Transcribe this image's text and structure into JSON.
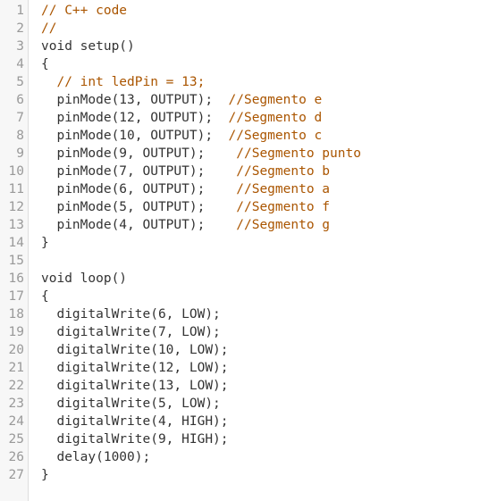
{
  "editor": {
    "lines": [
      {
        "n": "1",
        "code": "",
        "comment": "// C++ code"
      },
      {
        "n": "2",
        "code": "",
        "comment": "//"
      },
      {
        "n": "3",
        "code": "void setup()",
        "comment": ""
      },
      {
        "n": "4",
        "code": "{",
        "comment": ""
      },
      {
        "n": "5",
        "code": "  ",
        "comment": "// int ledPin = 13;"
      },
      {
        "n": "6",
        "code": "  pinMode(13, OUTPUT);  ",
        "comment": "//Segmento e"
      },
      {
        "n": "7",
        "code": "  pinMode(12, OUTPUT);  ",
        "comment": "//Segmento d"
      },
      {
        "n": "8",
        "code": "  pinMode(10, OUTPUT);  ",
        "comment": "//Segmento c"
      },
      {
        "n": "9",
        "code": "  pinMode(9, OUTPUT);    ",
        "comment": "//Segmento punto"
      },
      {
        "n": "10",
        "code": "  pinMode(7, OUTPUT);    ",
        "comment": "//Segmento b"
      },
      {
        "n": "11",
        "code": "  pinMode(6, OUTPUT);    ",
        "comment": "//Segmento a"
      },
      {
        "n": "12",
        "code": "  pinMode(5, OUTPUT);    ",
        "comment": "//Segmento f"
      },
      {
        "n": "13",
        "code": "  pinMode(4, OUTPUT);    ",
        "comment": "//Segmento g"
      },
      {
        "n": "14",
        "code": "}",
        "comment": ""
      },
      {
        "n": "15",
        "code": "",
        "comment": ""
      },
      {
        "n": "16",
        "code": "void loop()",
        "comment": ""
      },
      {
        "n": "17",
        "code": "{",
        "comment": ""
      },
      {
        "n": "18",
        "code": "  digitalWrite(6, LOW);",
        "comment": ""
      },
      {
        "n": "19",
        "code": "  digitalWrite(7, LOW);",
        "comment": ""
      },
      {
        "n": "20",
        "code": "  digitalWrite(10, LOW);",
        "comment": ""
      },
      {
        "n": "21",
        "code": "  digitalWrite(12, LOW);",
        "comment": ""
      },
      {
        "n": "22",
        "code": "  digitalWrite(13, LOW);",
        "comment": ""
      },
      {
        "n": "23",
        "code": "  digitalWrite(5, LOW);",
        "comment": ""
      },
      {
        "n": "24",
        "code": "  digitalWrite(4, HIGH);",
        "comment": ""
      },
      {
        "n": "25",
        "code": "  digitalWrite(9, HIGH);",
        "comment": ""
      },
      {
        "n": "26",
        "code": "  delay(1000);",
        "comment": ""
      },
      {
        "n": "27",
        "code": "}",
        "comment": ""
      }
    ],
    "colors": {
      "code": "#333333",
      "comment": "#aa5500",
      "line_number": "#999999",
      "gutter": "#f7f7f7"
    }
  }
}
